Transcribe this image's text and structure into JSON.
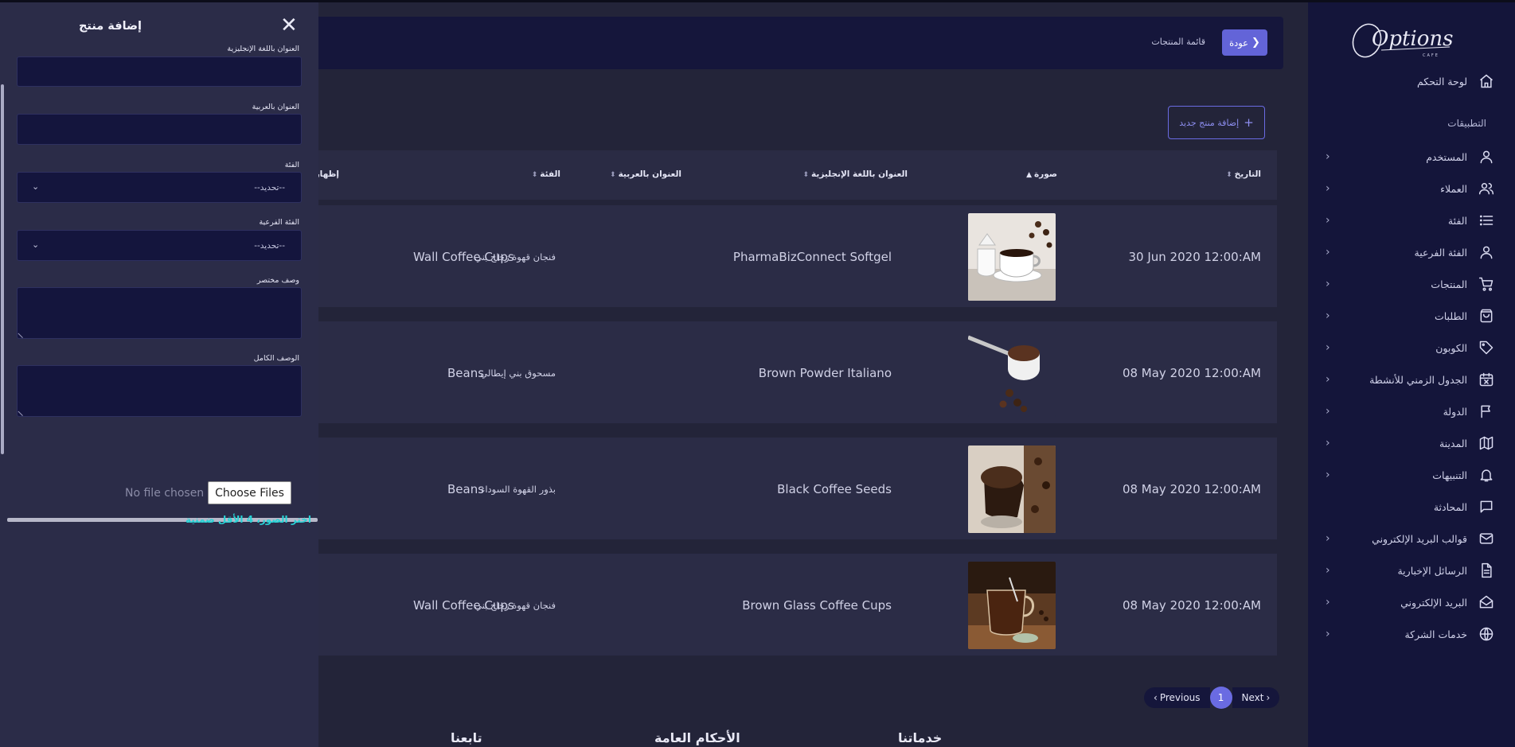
{
  "sidebar": {
    "logo_text": "Options",
    "logo_sub": "CAFE",
    "dashboard": "لوحة التحكم",
    "section_title": "التطبيقات",
    "items": [
      {
        "label": "المستخدم",
        "icon": "user-icon"
      },
      {
        "label": "العملاء",
        "icon": "users-icon"
      },
      {
        "label": "الفئة",
        "icon": "list-icon"
      },
      {
        "label": "الفئة الفرعية",
        "icon": "user-icon"
      },
      {
        "label": "المنتجات",
        "icon": "cart-icon"
      },
      {
        "label": "الطلبات",
        "icon": "bag-icon"
      },
      {
        "label": "الكوبون",
        "icon": "tag-icon"
      },
      {
        "label": "الجدول الزمني للأنشطة",
        "icon": "calendar-x-icon"
      },
      {
        "label": "الدولة",
        "icon": "flag-icon"
      },
      {
        "label": "المدينة",
        "icon": "map-icon"
      },
      {
        "label": "التنبيهات",
        "icon": "bell-icon"
      },
      {
        "label": "المحادثة",
        "icon": "chat-icon"
      },
      {
        "label": "قوالب البريد الإلكتروني",
        "icon": "mail-icon"
      },
      {
        "label": "الرسائل الإخبارية",
        "icon": "file-icon"
      },
      {
        "label": "البريد الإلكتروني",
        "icon": "envelope-open-icon"
      },
      {
        "label": "خدمات الشركة",
        "icon": "globe-icon"
      }
    ]
  },
  "header": {
    "back_label": "عودة",
    "breadcrumb": "قائمة المنتجات"
  },
  "toolbar": {
    "add_new_label": "إضافة منتج جديد"
  },
  "table": {
    "columns": {
      "date": "التاريخ",
      "image": "صورة",
      "title_en": "العنوان باللغة الإنجليزية",
      "title_ar": "العنوان بالعربية",
      "category": "الفئة",
      "show": "إظهار"
    },
    "rows": [
      {
        "date": "30 Jun 2020 12:00:AM",
        "title_en": "PharmaBizConnect Softgel",
        "title_ar": "فنجان قهوة زجاج بني",
        "category": "Wall Coffee Cups",
        "image": "coffee-cup-image"
      },
      {
        "date": "08 May 2020 12:00:AM",
        "title_en": "Brown Powder Italiano",
        "title_ar": "مسحوق بني إيطالي",
        "category": "Beans",
        "image": "coffee-scoop-image"
      },
      {
        "date": "08 May 2020 12:00:AM",
        "title_en": "Black Coffee Seeds",
        "title_ar": "بذور القهوة السوداء",
        "category": "Beans",
        "image": "coffee-grounds-image"
      },
      {
        "date": "08 May 2020 12:00:AM",
        "title_en": "Brown Glass Coffee Cups",
        "title_ar": "فنجان قهوة زجاج بني",
        "category": "Wall Coffee Cups",
        "image": "glass-coffee-cup-image"
      }
    ]
  },
  "pagination": {
    "previous": "Previous",
    "current": "1",
    "next": "Next"
  },
  "footer": {
    "services": "خدماتنا",
    "terms": "الأحكام العامة",
    "follow": "تابعنا"
  },
  "panel": {
    "title": "إضافة منتج",
    "fields": {
      "title_en": "العنوان باللغة الإنجليزية",
      "title_ar": "العنوان بالعربية",
      "category": "الفئة",
      "subcategory": "الفئة الفرعية",
      "short_desc": "وصف مختصر",
      "full_desc": "الوصف الكامل"
    },
    "select_placeholder": "--تحديد--",
    "file_none": "No file chosen",
    "choose_files": "Choose Files",
    "image_hint": "اختر الصور، 4 الأقل ضمنية"
  },
  "colors": {
    "accent": "#6364d8",
    "sidebar_bg": "#14153a",
    "page_bg": "#232439",
    "hint": "#27d3d6"
  }
}
